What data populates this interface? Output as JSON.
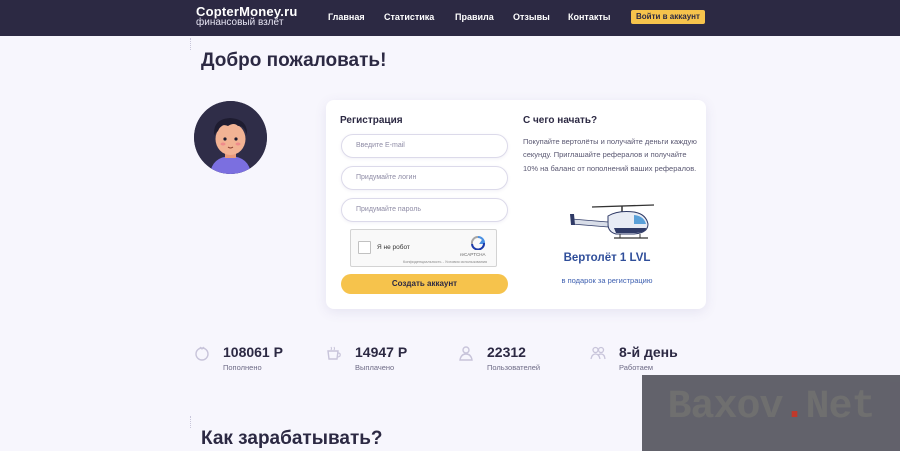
{
  "header": {
    "logo_main": "CopterMoney.ru",
    "logo_sub": "финансовый взлёт",
    "nav": [
      "Главная",
      "Статистика",
      "Правила",
      "Отзывы",
      "Контакты"
    ],
    "login_label": "Войти в аккаунт"
  },
  "welcome": "Добро пожаловать!",
  "registration": {
    "title": "Регистрация",
    "email_placeholder": "Введите E-mail",
    "login_placeholder": "Придумайте логин",
    "password_placeholder": "Придумайте пароль",
    "captcha_label": "Я не робот",
    "captcha_brand": "reCAPTCHA",
    "captcha_terms": "Конфиденциальность - Условия использования",
    "submit_label": "Создать аккаунт"
  },
  "start": {
    "title": "С чего начать?",
    "text": "Покупайте вертолёты и получайте деньги каждую секунду. Приглашайте рефералов и получайте 10% на баланс от пополнений ваших рефералов.",
    "helicopter_name": "Вертолёт 1 LVL",
    "helicopter_gift": "в подарок за регистрацию"
  },
  "stats": [
    {
      "value": "108061 Р",
      "label": "Пополнено",
      "icon": "coin-icon"
    },
    {
      "value": "14947 Р",
      "label": "Выплачено",
      "icon": "cup-icon"
    },
    {
      "value": "22312",
      "label": "Пользователей",
      "icon": "users-icon"
    },
    {
      "value": "8-й день",
      "label": "Работаем",
      "icon": "people-icon"
    }
  ],
  "how_title": "Как зарабатывать?",
  "watermark": {
    "part1": "Baxov",
    "dot": ".",
    "part2": "Net"
  },
  "colors": {
    "header_bg": "#2c2943",
    "accent": "#f6c34c",
    "link_blue": "#2f4e9a"
  }
}
